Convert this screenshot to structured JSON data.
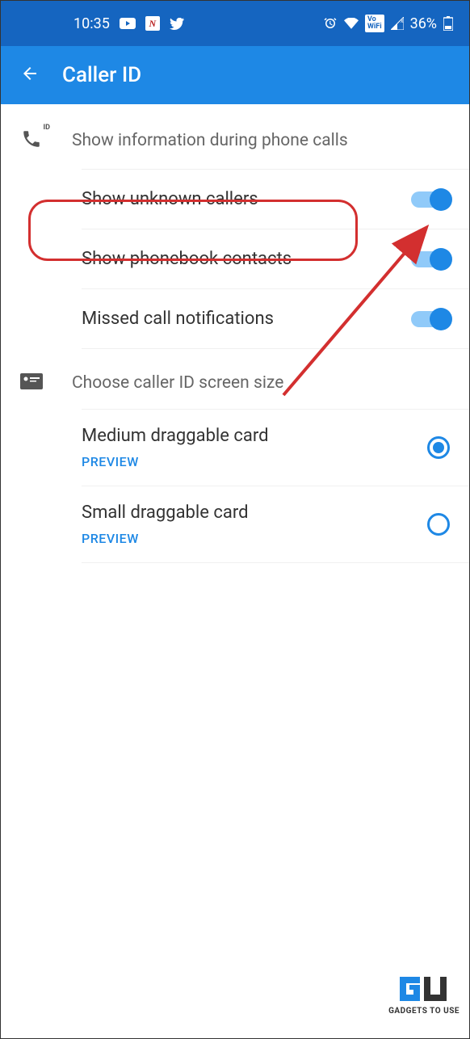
{
  "statusBar": {
    "time": "10:35",
    "battery": "36%"
  },
  "appBar": {
    "title": "Caller ID"
  },
  "sections": {
    "callerInfo": {
      "title": "Show information during phone calls",
      "items": {
        "unknownCallers": "Show unknown callers",
        "phonebookContacts": "Show phonebook contacts",
        "missedCallNotif": "Missed call notifications"
      }
    },
    "screenSize": {
      "title": "Choose caller ID screen size",
      "items": {
        "mediumCard": {
          "label": "Medium draggable card",
          "preview": "PREVIEW"
        },
        "smallCard": {
          "label": "Small draggable card",
          "preview": "PREVIEW"
        }
      }
    }
  },
  "watermark": {
    "text": "GADGETS TO USE"
  }
}
